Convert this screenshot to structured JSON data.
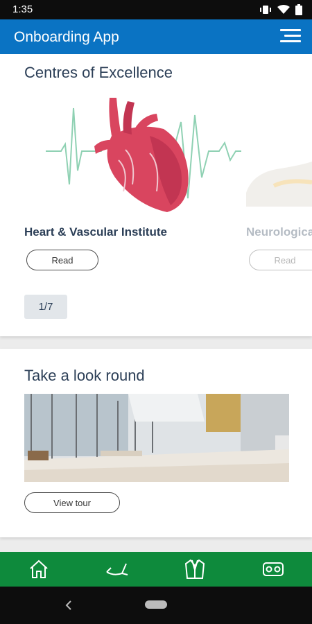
{
  "status_bar": {
    "time": "1:35"
  },
  "app_bar": {
    "title": "Onboarding App"
  },
  "centres": {
    "title": "Centres of Excellence",
    "items": [
      {
        "title": "Heart & Vascular Institute",
        "button": "Read"
      },
      {
        "title": "Neurological",
        "button": "Read"
      }
    ],
    "pager": "1/7"
  },
  "tour": {
    "title": "Take a look round",
    "button": "View tour"
  },
  "bottom_nav": {
    "items": [
      "home-icon",
      "medical-icon",
      "lab-coat-icon",
      "vr-headset-icon"
    ],
    "accent": "#0e8a3c"
  },
  "colors": {
    "app_bar": "#0a73c3",
    "heading": "#2c3f57"
  }
}
